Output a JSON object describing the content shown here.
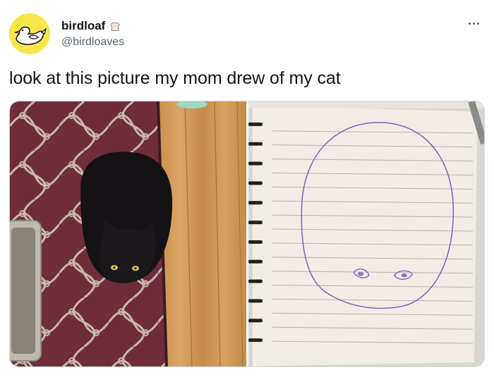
{
  "tweet": {
    "display_name": "birdloaf",
    "handle": "@birdloaves",
    "text": "look at this picture my mom drew of my cat",
    "icons": {
      "avatar": "bird-loaf-avatar",
      "badge": "bread-icon",
      "more": "more-options-icon"
    },
    "colors": {
      "avatar_bg": "#f8e54a",
      "name": "#0f1419",
      "handle": "#536471"
    }
  },
  "media": {
    "count": 2
  }
}
